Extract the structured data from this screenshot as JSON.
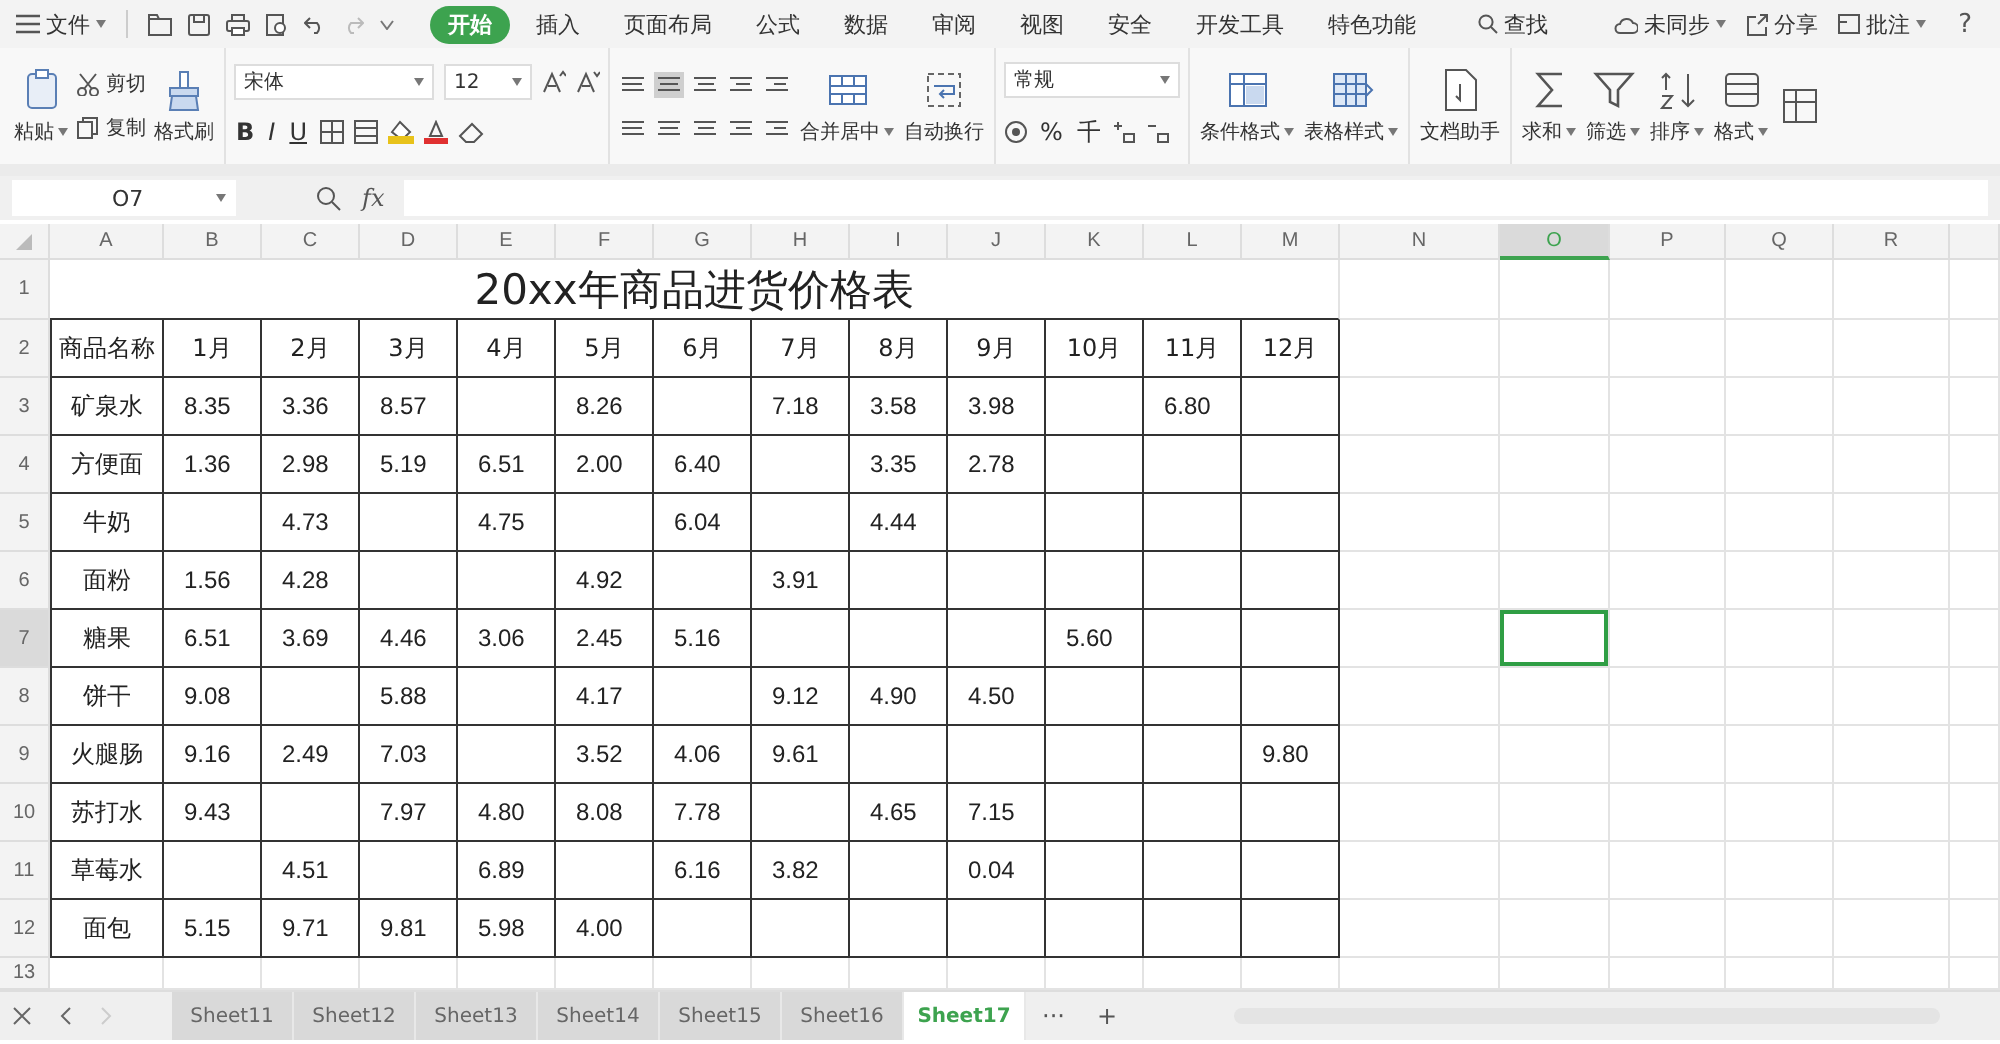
{
  "menu_bar": {
    "file_menu": "文件",
    "tabs": [
      {
        "label": "开始",
        "selected": true
      },
      {
        "label": "插入",
        "selected": false
      },
      {
        "label": "页面布局",
        "selected": false
      },
      {
        "label": "公式",
        "selected": false
      },
      {
        "label": "数据",
        "selected": false
      },
      {
        "label": "审阅",
        "selected": false
      },
      {
        "label": "视图",
        "selected": false
      },
      {
        "label": "安全",
        "selected": false
      },
      {
        "label": "开发工具",
        "selected": false
      },
      {
        "label": "特色功能",
        "selected": false
      }
    ],
    "search": "查找",
    "status": [
      {
        "label": "未同步",
        "dropdown": true
      },
      {
        "label": "分享",
        "dropdown": false
      },
      {
        "label": "批注",
        "dropdown": true
      }
    ],
    "help": "?"
  },
  "ribbon": {
    "groups": [
      {
        "kind": "buttons",
        "items": [
          {
            "kind": "large",
            "label": "粘贴",
            "dropdown": true
          },
          {
            "kind": "small",
            "label": "剪切"
          },
          {
            "kind": "small",
            "label": "复制"
          },
          {
            "kind": "large",
            "label": "格式刷",
            "dropdown": false
          }
        ]
      },
      {
        "kind": "font",
        "font_name": "宋体",
        "font_size": "12",
        "styles": [
          "B",
          "I",
          "U"
        ]
      },
      {
        "kind": "align",
        "tools": [
          {
            "selected": false
          },
          {
            "selected": true
          },
          {
            "selected": false
          },
          {
            "selected": false
          },
          {
            "selected": false
          },
          {
            "selected": false
          },
          {
            "selected": false
          },
          {
            "selected": false
          },
          {
            "selected": false
          },
          {
            "selected": false
          }
        ],
        "items": [
          {
            "kind": "large",
            "label": "合并居中",
            "dropdown": true
          },
          {
            "kind": "large",
            "label": "自动换行",
            "dropdown": false
          }
        ]
      },
      {
        "kind": "number",
        "format": "常规",
        "symbols": [
          "%",
          "千"
        ]
      },
      {
        "kind": "buttons",
        "items": [
          {
            "kind": "large",
            "label": "条件格式",
            "dropdown": true
          },
          {
            "kind": "large",
            "label": "表格样式",
            "dropdown": true
          }
        ]
      },
      {
        "kind": "buttons",
        "items": [
          {
            "kind": "large",
            "label": "文档助手",
            "dropdown": false
          }
        ]
      },
      {
        "kind": "buttons",
        "items": [
          {
            "kind": "large",
            "label": "求和",
            "dropdown": true
          },
          {
            "kind": "large",
            "label": "筛选",
            "dropdown": true
          },
          {
            "kind": "large",
            "label": "排序",
            "dropdown": true
          },
          {
            "kind": "large",
            "label": "格式",
            "dropdown": true
          },
          {
            "kind": "large"
          }
        ]
      }
    ]
  },
  "formula_bar": {
    "name_box": "O7",
    "fx": "fx"
  },
  "sheet": {
    "columns": [
      {
        "label": "A",
        "selected": false
      },
      {
        "label": "B",
        "selected": false
      },
      {
        "label": "C",
        "selected": false
      },
      {
        "label": "D",
        "selected": false
      },
      {
        "label": "E",
        "selected": false
      },
      {
        "label": "F",
        "selected": false
      },
      {
        "label": "G",
        "selected": false
      },
      {
        "label": "H",
        "selected": false
      },
      {
        "label": "I",
        "selected": false
      },
      {
        "label": "J",
        "selected": false
      },
      {
        "label": "K",
        "selected": false
      },
      {
        "label": "L",
        "selected": false
      },
      {
        "label": "M",
        "selected": false
      },
      {
        "label": "N",
        "selected": false
      },
      {
        "label": "O",
        "selected": true
      },
      {
        "label": "P",
        "selected": false
      },
      {
        "label": "Q",
        "selected": false
      },
      {
        "label": "R",
        "selected": false
      }
    ],
    "rows": [
      {
        "number": "1",
        "kind": "title",
        "selected": false,
        "title": "20xx年商品进货价格表"
      },
      {
        "number": "2",
        "kind": "header",
        "selected": false,
        "cells": [
          "商品名称",
          "1月",
          "2月",
          "3月",
          "4月",
          "5月",
          "6月",
          "7月",
          "8月",
          "9月",
          "10月",
          "11月",
          "12月"
        ]
      },
      {
        "number": "3",
        "kind": "data",
        "selected": false,
        "cells": [
          "矿泉水",
          "8.35",
          "3.36",
          "8.57",
          null,
          "8.26",
          null,
          "7.18",
          "3.58",
          "3.98",
          null,
          "6.80",
          null
        ]
      },
      {
        "number": "4",
        "kind": "data",
        "selected": false,
        "cells": [
          "方便面",
          "1.36",
          "2.98",
          "5.19",
          "6.51",
          "2.00",
          "6.40",
          null,
          "3.35",
          "2.78",
          null,
          null,
          null
        ]
      },
      {
        "number": "5",
        "kind": "data",
        "selected": false,
        "cells": [
          "牛奶",
          null,
          "4.73",
          null,
          "4.75",
          null,
          "6.04",
          null,
          "4.44",
          null,
          null,
          null,
          null
        ]
      },
      {
        "number": "6",
        "kind": "data",
        "selected": false,
        "cells": [
          "面粉",
          "1.56",
          "4.28",
          null,
          null,
          "4.92",
          null,
          "3.91",
          null,
          null,
          null,
          null,
          null
        ]
      },
      {
        "number": "7",
        "kind": "data",
        "selected": true,
        "cells": [
          "糖果",
          "6.51",
          "3.69",
          "4.46",
          "3.06",
          "2.45",
          "5.16",
          null,
          null,
          null,
          "5.60",
          null,
          null
        ]
      },
      {
        "number": "8",
        "kind": "data",
        "selected": false,
        "cells": [
          "饼干",
          "9.08",
          null,
          "5.88",
          null,
          "4.17",
          null,
          "9.12",
          "4.90",
          "4.50",
          null,
          null,
          null
        ]
      },
      {
        "number": "9",
        "kind": "data",
        "selected": false,
        "cells": [
          "火腿肠",
          "9.16",
          "2.49",
          "7.03",
          null,
          "3.52",
          "4.06",
          "9.61",
          null,
          null,
          null,
          null,
          "9.80"
        ]
      },
      {
        "number": "10",
        "kind": "data",
        "selected": false,
        "cells": [
          "苏打水",
          "9.43",
          null,
          "7.97",
          "4.80",
          "8.08",
          "7.78",
          null,
          "4.65",
          "7.15",
          null,
          null,
          null
        ]
      },
      {
        "number": "11",
        "kind": "data",
        "selected": false,
        "cells": [
          "草莓水",
          null,
          "4.51",
          null,
          "6.89",
          null,
          "6.16",
          "3.82",
          null,
          "0.04",
          null,
          null,
          null
        ]
      },
      {
        "number": "12",
        "kind": "data",
        "selected": false,
        "cells": [
          "面包",
          "5.15",
          "9.71",
          "9.81",
          "5.98",
          "4.00",
          null,
          null,
          null,
          null,
          null,
          null,
          null
        ]
      },
      {
        "number": "13",
        "kind": "blank",
        "selected": false
      }
    ]
  },
  "sheet_tabs": {
    "tabs": [
      {
        "label": "Sheet11",
        "selected": false
      },
      {
        "label": "Sheet12",
        "selected": false
      },
      {
        "label": "Sheet13",
        "selected": false
      },
      {
        "label": "Sheet14",
        "selected": false
      },
      {
        "label": "Sheet15",
        "selected": false
      },
      {
        "label": "Sheet16",
        "selected": false
      },
      {
        "label": "Sheet17",
        "selected": true
      }
    ],
    "more": "···",
    "add": "+"
  }
}
